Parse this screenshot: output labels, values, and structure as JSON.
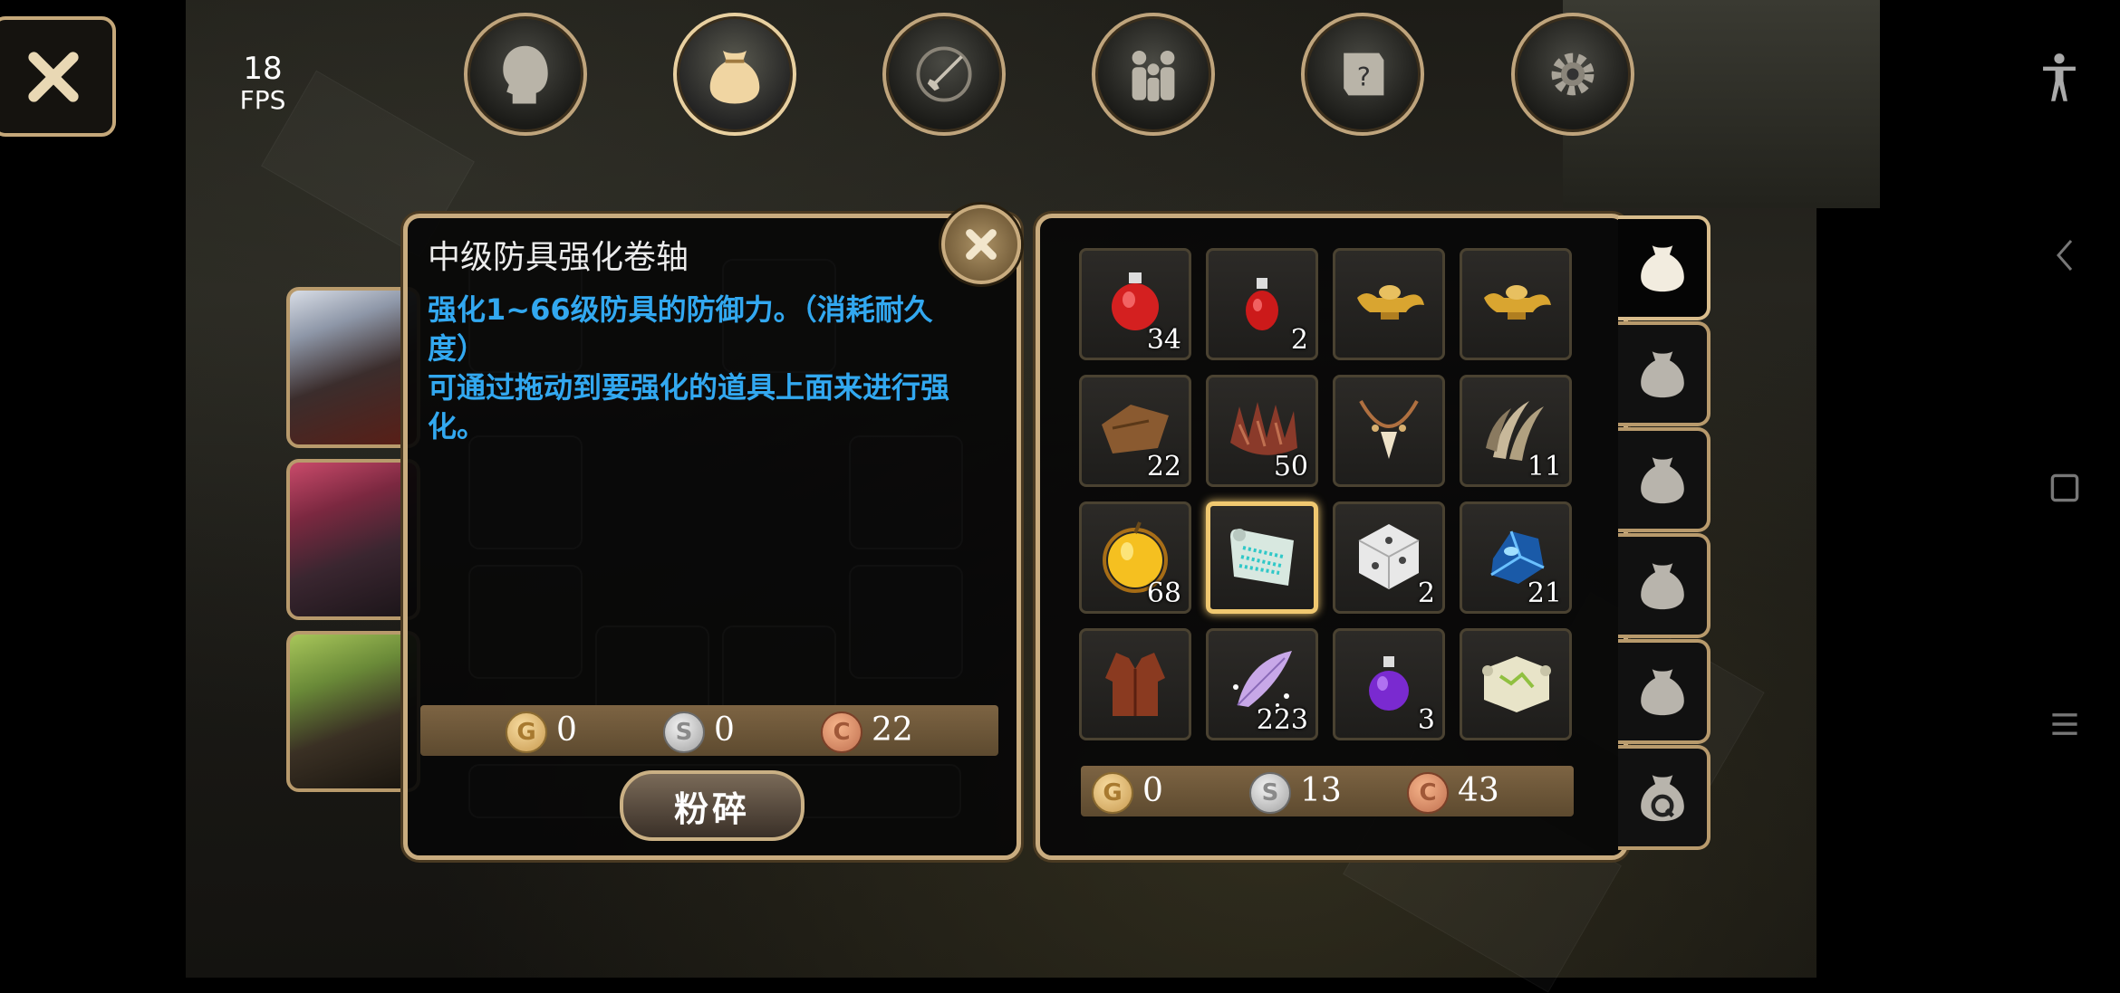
{
  "hud": {
    "fps_value": "18",
    "fps_label": "FPS"
  },
  "top_nav": [
    {
      "name": "character-tab-button",
      "icon": "head-icon",
      "active": false
    },
    {
      "name": "inventory-tab-button",
      "icon": "bag-icon",
      "active": true
    },
    {
      "name": "skills-tab-button",
      "icon": "sword-icon",
      "active": false
    },
    {
      "name": "party-tab-button",
      "icon": "people-icon",
      "active": false
    },
    {
      "name": "quest-tab-button",
      "icon": "scroll-question-icon",
      "active": false
    },
    {
      "name": "settings-tab-button",
      "icon": "gear-icon",
      "active": false
    }
  ],
  "item_detail": {
    "title": "中级防具强化卷轴",
    "description_line1": "强化1~66级防具的防御力。（消耗耐久度）",
    "description_line2": "可通过拖动到要强化的道具上面来进行强化。",
    "money": {
      "gold": "0",
      "silver": "0",
      "copper": "22"
    },
    "smash_button": "粉碎"
  },
  "inventory": {
    "items": [
      {
        "icon": "red-potion-large-icon",
        "count": "34"
      },
      {
        "icon": "red-potion-small-icon",
        "count": "2"
      },
      {
        "icon": "golden-lamp-icon",
        "count": ""
      },
      {
        "icon": "golden-lamp-icon",
        "count": ""
      },
      {
        "icon": "leather-hide-icon",
        "count": "22"
      },
      {
        "icon": "fur-pelt-icon",
        "count": "50"
      },
      {
        "icon": "fang-necklace-icon",
        "count": ""
      },
      {
        "icon": "claw-icon",
        "count": "11"
      },
      {
        "icon": "golden-apple-icon",
        "count": "68"
      },
      {
        "icon": "enchant-scroll-icon",
        "count": "",
        "selected": true
      },
      {
        "icon": "dice-icon",
        "count": "2"
      },
      {
        "icon": "blue-crystal-icon",
        "count": "21"
      },
      {
        "icon": "leather-armor-icon",
        "count": ""
      },
      {
        "icon": "magic-feather-icon",
        "count": "223"
      },
      {
        "icon": "purple-potion-icon",
        "count": "3"
      },
      {
        "icon": "map-scroll-icon",
        "count": ""
      }
    ],
    "money": {
      "gold": "0",
      "silver": "13",
      "copper": "43"
    }
  },
  "bag_tabs": [
    "bag-icon",
    "bag-icon",
    "bag-icon",
    "bag-icon",
    "bag-icon",
    "quest-bag-icon"
  ],
  "colors": {
    "frame": "#c9ac7f",
    "description": "#32a8f0",
    "money_bar": "#6d5638",
    "selected_slot": "#f0c870"
  }
}
